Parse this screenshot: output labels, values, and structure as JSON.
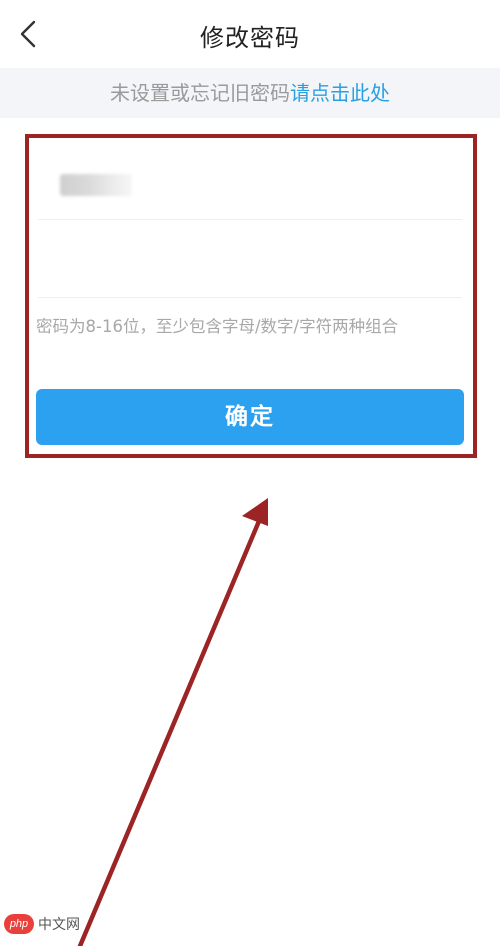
{
  "header": {
    "title": "修改密码"
  },
  "notice": {
    "text": "未设置或忘记旧密码",
    "link": "请点击此处"
  },
  "form": {
    "current_field_value": "",
    "new_password_value": "",
    "hint": "密码为8-16位，至少包含字母/数字/字符两种组合",
    "confirm_label": "确定"
  },
  "annotation": {
    "box_color": "#9c2424",
    "arrow_color": "#9c2424"
  },
  "colors": {
    "accent": "#2ba1ef",
    "link": "#2aa0e4"
  },
  "watermark": {
    "badge": "php",
    "text": "中文网"
  }
}
